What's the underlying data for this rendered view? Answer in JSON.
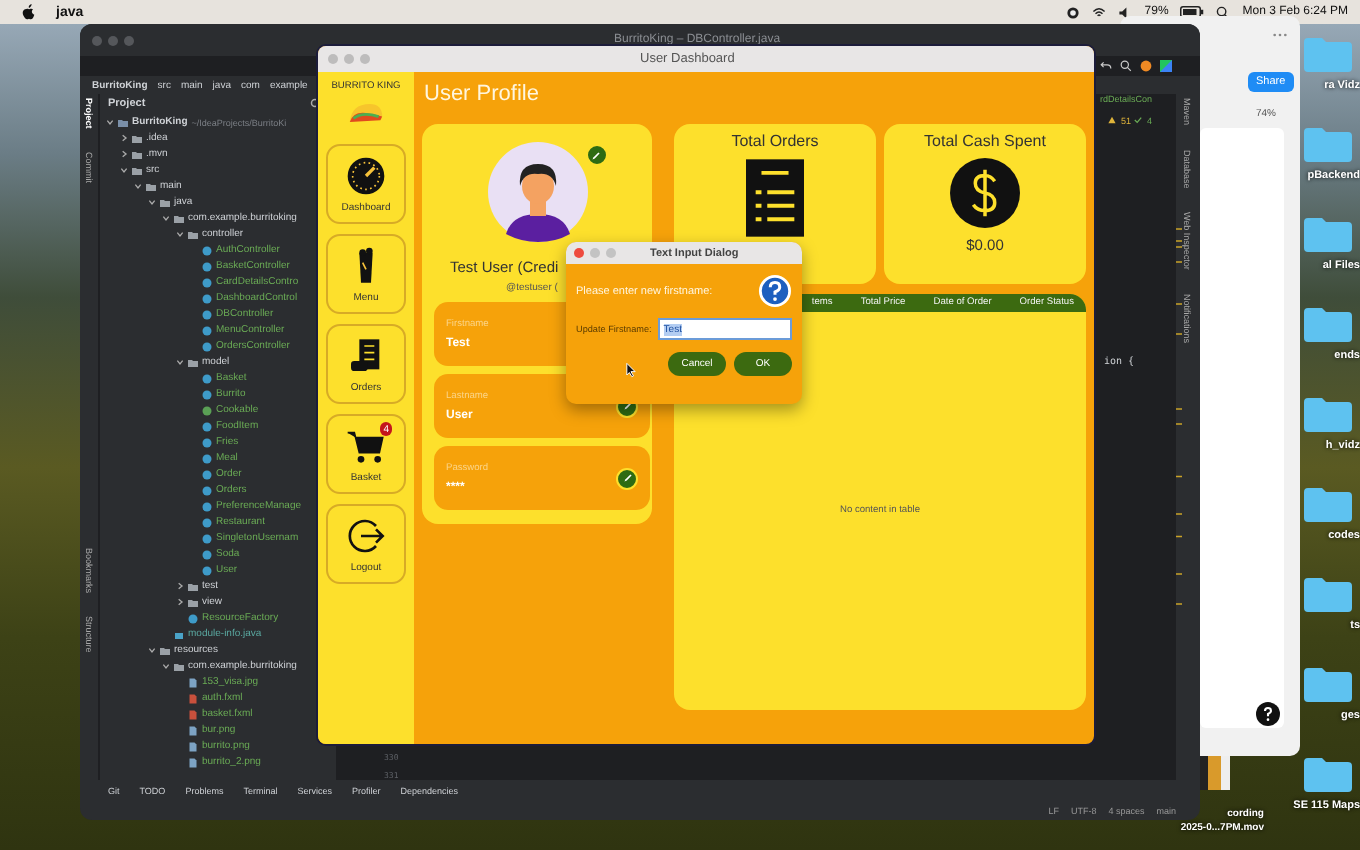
{
  "menubar": {
    "app": "java",
    "battery": "79%",
    "clock": "Mon 3 Feb 6:24 PM"
  },
  "ide": {
    "title": "BurritoKing – DBController.java",
    "breadcrumbs": [
      "BurritoKing",
      "src",
      "main",
      "java",
      "com",
      "example"
    ],
    "panel_title": "Project",
    "left_tabs": [
      "Project",
      "Commit",
      "Bookmarks",
      "Structure"
    ],
    "right_tabs": [
      "Maven",
      "Database",
      "Web Inspector",
      "Notifications"
    ],
    "editor_tab": "rdDetailsCon",
    "warnings": "51",
    "checks": "4",
    "code_fragment": "ion {",
    "line_numbers": [
      "330",
      "331"
    ],
    "tree": [
      {
        "name": "BurritoKing",
        "kind": "project",
        "path": "~/IdeaProjects/BurritoKi",
        "expanded": true,
        "children": [
          {
            "name": ".idea",
            "kind": "folder",
            "expanded": false
          },
          {
            "name": ".mvn",
            "kind": "folder",
            "expanded": false
          },
          {
            "name": "src",
            "kind": "folder",
            "expanded": true,
            "children": [
              {
                "name": "main",
                "kind": "folder",
                "expanded": true,
                "children": [
                  {
                    "name": "java",
                    "kind": "folder",
                    "expanded": true,
                    "children": [
                      {
                        "name": "com.example.burritoking",
                        "kind": "package",
                        "expanded": true,
                        "children": [
                          {
                            "name": "controller",
                            "kind": "package",
                            "expanded": true,
                            "children": [
                              {
                                "name": "AuthController",
                                "kind": "class"
                              },
                              {
                                "name": "BasketController",
                                "kind": "class"
                              },
                              {
                                "name": "CardDetailsContro",
                                "kind": "class"
                              },
                              {
                                "name": "DashboardControl",
                                "kind": "class"
                              },
                              {
                                "name": "DBController",
                                "kind": "class"
                              },
                              {
                                "name": "MenuController",
                                "kind": "class"
                              },
                              {
                                "name": "OrdersController",
                                "kind": "class"
                              }
                            ]
                          },
                          {
                            "name": "model",
                            "kind": "package",
                            "expanded": true,
                            "children": [
                              {
                                "name": "Basket",
                                "kind": "class"
                              },
                              {
                                "name": "Burrito",
                                "kind": "class"
                              },
                              {
                                "name": "Cookable",
                                "kind": "interface"
                              },
                              {
                                "name": "FoodItem",
                                "kind": "class"
                              },
                              {
                                "name": "Fries",
                                "kind": "class"
                              },
                              {
                                "name": "Meal",
                                "kind": "class"
                              },
                              {
                                "name": "Order",
                                "kind": "class"
                              },
                              {
                                "name": "Orders",
                                "kind": "class"
                              },
                              {
                                "name": "PreferenceManage",
                                "kind": "class"
                              },
                              {
                                "name": "Restaurant",
                                "kind": "class"
                              },
                              {
                                "name": "SingletonUsernam",
                                "kind": "class"
                              },
                              {
                                "name": "Soda",
                                "kind": "class"
                              },
                              {
                                "name": "User",
                                "kind": "class"
                              }
                            ]
                          },
                          {
                            "name": "test",
                            "kind": "package",
                            "expanded": false
                          },
                          {
                            "name": "view",
                            "kind": "package",
                            "expanded": false
                          },
                          {
                            "name": "ResourceFactory",
                            "kind": "class"
                          }
                        ]
                      },
                      {
                        "name": "module-info.java",
                        "kind": "module"
                      }
                    ]
                  },
                  {
                    "name": "resources",
                    "kind": "folder",
                    "expanded": true,
                    "children": [
                      {
                        "name": "com.example.burritoking",
                        "kind": "package",
                        "expanded": true,
                        "children": [
                          {
                            "name": "153_visa.jpg",
                            "kind": "image"
                          },
                          {
                            "name": "auth.fxml",
                            "kind": "fxml"
                          },
                          {
                            "name": "basket.fxml",
                            "kind": "fxml"
                          },
                          {
                            "name": "bur.png",
                            "kind": "image"
                          },
                          {
                            "name": "burrito.png",
                            "kind": "image"
                          },
                          {
                            "name": "burrito_2.png",
                            "kind": "image"
                          }
                        ]
                      }
                    ]
                  }
                ]
              }
            ]
          }
        ]
      }
    ],
    "bottom_tabs": [
      "Git",
      "TODO",
      "Problems",
      "Terminal",
      "Services",
      "Profiler",
      "Dependencies"
    ],
    "status": [
      "LF",
      "UTF-8",
      "4 spaces",
      "main"
    ]
  },
  "app": {
    "title": "User Dashboard",
    "brand": "BURRITO KING",
    "heading": "User Profile",
    "nav": [
      {
        "label": "Dashboard",
        "kind": "dashboard"
      },
      {
        "label": "Menu",
        "kind": "menu"
      },
      {
        "label": "Orders",
        "kind": "orders"
      },
      {
        "label": "Basket",
        "kind": "basket",
        "badge": "4"
      },
      {
        "label": "Logout",
        "kind": "logout"
      }
    ],
    "profile": {
      "name": "Test User (Credi",
      "handle": "@testuser (",
      "fields": [
        {
          "label": "Firstname",
          "value": "Test"
        },
        {
          "label": "Lastname",
          "value": "User"
        },
        {
          "label": "Password",
          "value": "****"
        }
      ]
    },
    "stats": [
      {
        "title": "Total Orders",
        "kind": "orders"
      },
      {
        "title": "Total Cash Spent",
        "kind": "cash",
        "value": "$0.00"
      }
    ],
    "table": {
      "columns": [
        "tems",
        "Total Price",
        "Date of Order",
        "Order Status"
      ],
      "empty_text": "No content in table"
    }
  },
  "dialog": {
    "title": "Text Input Dialog",
    "header": "Please enter new firstname:",
    "label": "Update Firstname:",
    "value": "Test",
    "buttons": [
      "Cancel",
      "OK"
    ]
  },
  "browser": {
    "share": "Share",
    "zoom": "74%"
  },
  "desktop": {
    "folders": [
      "ra Vidz",
      "pBackend",
      "al Files",
      "ends",
      "h_vidz",
      "codes",
      "ts",
      "ges",
      "SE 115 Maps"
    ],
    "recording": [
      "cording",
      "2025-0...7PM.mov"
    ]
  }
}
